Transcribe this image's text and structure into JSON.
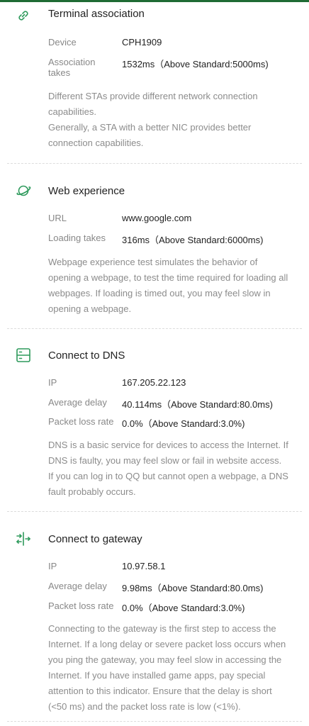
{
  "accent_color": "#2e9a5c",
  "sections": [
    {
      "icon": "link-icon",
      "title": "Terminal association",
      "rows": [
        {
          "label": "Device",
          "value": "CPH1909"
        },
        {
          "label": "Association\ntakes",
          "value": "1532ms（Above Standard:5000ms)"
        }
      ],
      "description": "Different STAs provide different network connection capabilities.\n Generally, a STA with a better NIC provides better connection capabilities."
    },
    {
      "icon": "planet-icon",
      "title": "Web experience",
      "rows": [
        {
          "label": "URL",
          "value": "www.google.com"
        },
        {
          "label": "Loading takes",
          "value": "316ms（Above Standard:6000ms)"
        }
      ],
      "description": "Webpage experience test simulates the behavior of opening a webpage, to test the time required for loading all webpages. If loading is timed out, you may feel slow in opening a webpage."
    },
    {
      "icon": "server-icon",
      "title": "Connect to DNS",
      "rows": [
        {
          "label": "IP",
          "value": "167.205.22.123"
        },
        {
          "label": "Average delay",
          "value": "40.114ms（Above Standard:80.0ms)"
        },
        {
          "label": "Packet loss rate",
          "value": "0.0%（Above Standard:3.0%)"
        }
      ],
      "description": "DNS is a basic service for devices to access the Internet. If DNS is faulty, you may feel slow or fail in website access. If you can log in to QQ but cannot open a webpage, a DNS fault probably occurs."
    },
    {
      "icon": "gateway-icon",
      "title": "Connect to gateway",
      "rows": [
        {
          "label": "IP",
          "value": "10.97.58.1"
        },
        {
          "label": "Average delay",
          "value": "9.98ms（Above Standard:80.0ms)"
        },
        {
          "label": "Packet loss rate",
          "value": "0.0%（Above Standard:3.0%)"
        }
      ],
      "description": "Connecting to the gateway is the first step to access the Internet. If a long delay or severe packet loss occurs when you ping the gateway, you may feel slow in accessing the Internet. If you have installed game apps, pay special attention to this indicator. Ensure that the delay is short (<50 ms) and the packet loss rate is low (<1%)."
    }
  ]
}
